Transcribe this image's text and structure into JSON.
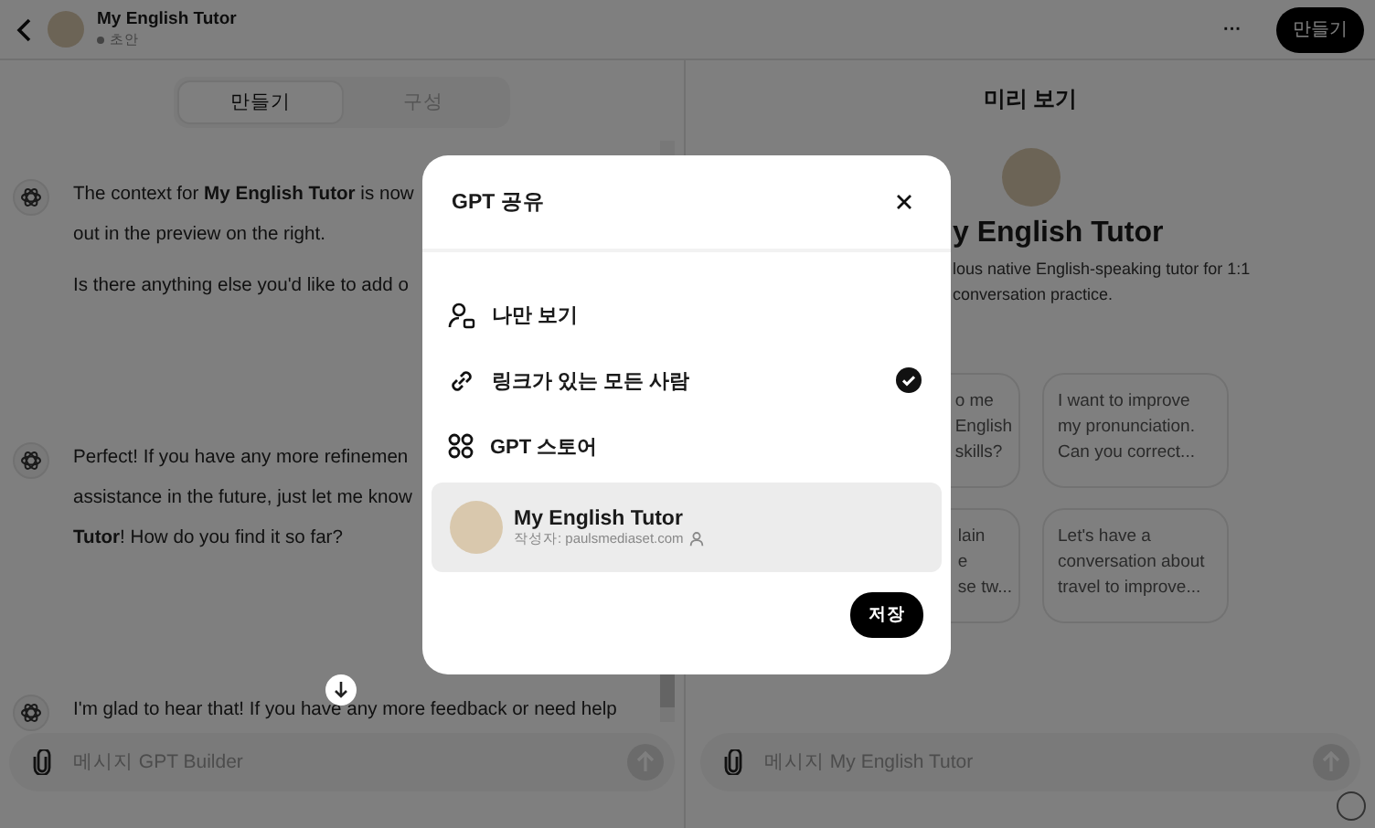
{
  "header": {
    "title": "My English Tutor",
    "status": "초안",
    "more_label": "···",
    "action": "만들기"
  },
  "tabs": [
    {
      "label": "만들기",
      "selected": true
    },
    {
      "label": "구성",
      "selected": false
    }
  ],
  "messages": [
    {
      "paragraphs": [
        "The context for **My English Tutor** is now\nout in the preview on the right.",
        "Is there anything else you'd like to add o"
      ]
    },
    {
      "paragraphs": [
        "Perfect! If you have any more refinemen\nassistance in the future, just let me know\n**Tutor**! How do you find it so far?"
      ]
    },
    {
      "paragraphs": [
        "I'm glad to hear that! If you have any more feedback or need help"
      ]
    }
  ],
  "builder_input": {
    "placeholder": "메시지 GPT Builder"
  },
  "preview": {
    "heading": "미리 보기",
    "title": "y English Tutor",
    "description": "lous native English-speaking tutor for 1:1\nconversation practice.",
    "starters": [
      {
        "text": "o me\nEnglish\nskills?",
        "kind": "partial"
      },
      {
        "text": "I want to improve\nmy pronunciation.\nCan you correct...",
        "kind": "full"
      },
      {
        "text": "lain\ne\nse tw...",
        "kind": "partial"
      },
      {
        "text": "Let's have a\nconversation about\ntravel to improve...",
        "kind": "full"
      }
    ],
    "input": {
      "placeholder": "메시지 My English Tutor"
    }
  },
  "dialog": {
    "title": "GPT 공유",
    "options": [
      {
        "label": "나만 보기",
        "kind": "private",
        "selected": false
      },
      {
        "label": "링크가 있는 모든 사람",
        "kind": "link",
        "selected": true
      },
      {
        "label": "GPT 스토어",
        "kind": "store",
        "selected": false
      }
    ],
    "gpt": {
      "name": "My English Tutor",
      "author": "작성자: paulsmediaset.com"
    },
    "save": "저장"
  }
}
